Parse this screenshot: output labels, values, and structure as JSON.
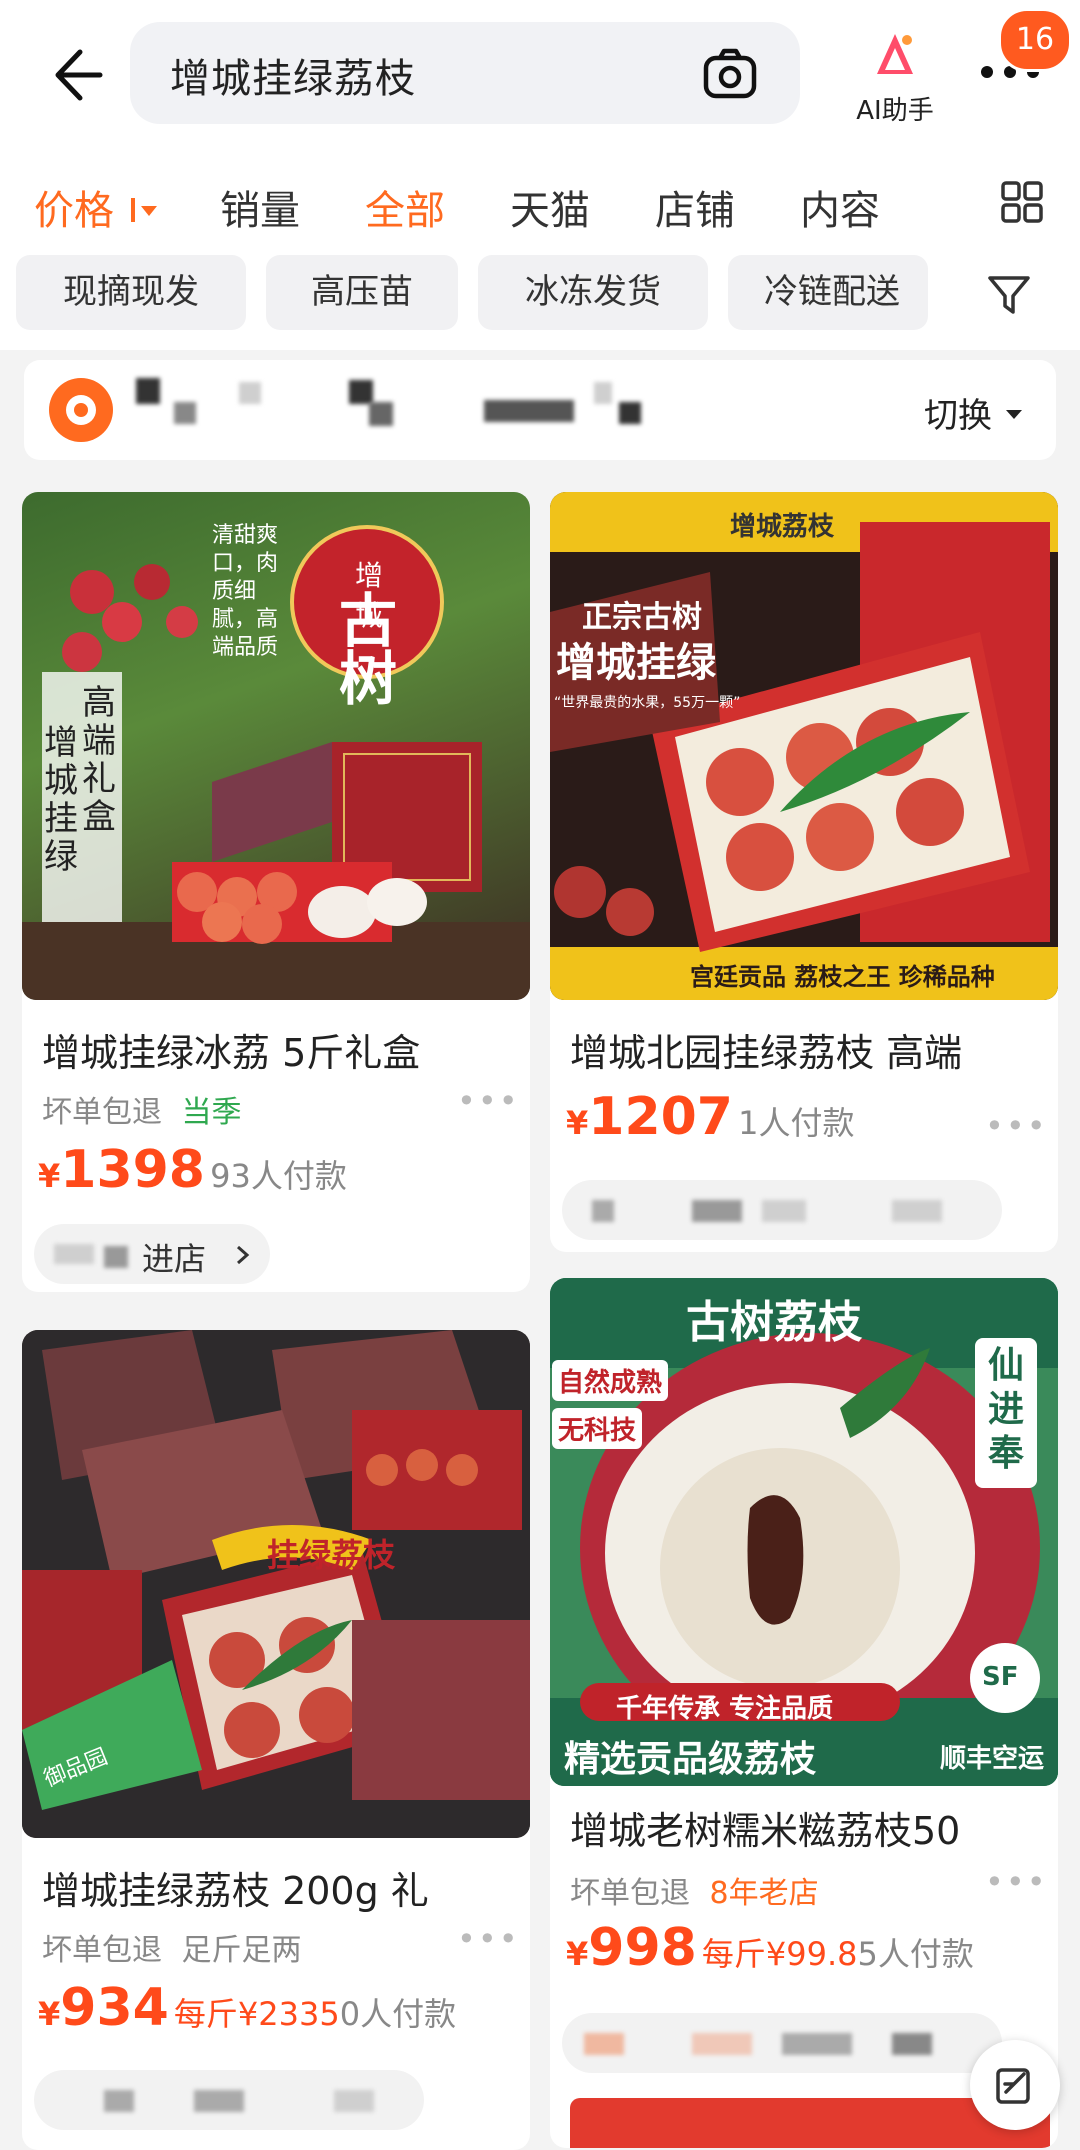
{
  "search": {
    "query": "增城挂绿荔枝"
  },
  "header": {
    "ai_label": "AI助手",
    "badge_count": "16"
  },
  "tabs": [
    {
      "label": "价格"
    },
    {
      "label": "销量"
    },
    {
      "label": "全部"
    },
    {
      "label": "天猫"
    },
    {
      "label": "店铺"
    },
    {
      "label": "内容"
    }
  ],
  "chips": [
    {
      "label": "现摘现发"
    },
    {
      "label": "高压苗"
    },
    {
      "label": "冰冻发货"
    },
    {
      "label": "冷链配送"
    }
  ],
  "shop_row": {
    "switch_label": "切换"
  },
  "products": [
    {
      "title": "增城挂绿冰荔 5斤礼盒",
      "tag1": "坏单包退",
      "tag2": "当季",
      "yen": "¥",
      "price": "1398",
      "sold": "93人付款",
      "enter": "进店",
      "image_text": [
        "增城",
        "古树",
        "高端礼盒",
        "增城挂绿",
        "清甜爽口，肉质细腻，高端品质"
      ]
    },
    {
      "title": "增城北园挂绿荔枝 高端",
      "yen": "¥",
      "price": "1207",
      "sold": "1人付款",
      "image_text": [
        "增城荔枝",
        "正宗古树",
        "增城挂绿",
        "“世界最贵的水果，55万一颗”",
        "宫廷贡品 荔枝之王 珍稀品种"
      ]
    },
    {
      "title": "增城挂绿荔枝 200g 礼",
      "tag1": "坏单包退",
      "tag2": "足斤足两",
      "yen": "¥",
      "price": "934",
      "unit_price": "每斤¥2335",
      "sold": "0人付款",
      "image_text": [
        "挂绿荔枝",
        "御品园"
      ]
    },
    {
      "title": "增城老树糯米糍荔枝50",
      "tag1": "坏单包退",
      "tag2": "8年老店",
      "yen": "¥",
      "price": "998",
      "unit_price": "每斤¥99.8",
      "sold": "5人付款",
      "image_text": [
        "古树荔枝",
        "自然成熟",
        "无科技",
        "仙进奉",
        "千年传承 专注品质",
        "精选贡品级荔枝",
        "顺丰空运",
        "SF"
      ]
    }
  ],
  "colors": {
    "accent": "#ff6a1f",
    "price": "#ff4a1a"
  }
}
